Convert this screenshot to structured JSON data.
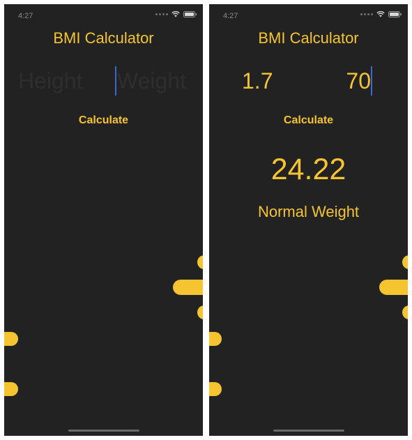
{
  "status": {
    "time": "4:27"
  },
  "app": {
    "title": "BMI Calculator",
    "calculate_label": "Calculate"
  },
  "left_screen": {
    "height_placeholder": "Height",
    "weight_placeholder": "Weight"
  },
  "right_screen": {
    "height_value": "1.7",
    "weight_value": "70",
    "bmi_value": "24.22",
    "bmi_category": "Normal Weight"
  },
  "colors": {
    "accent": "#f6c431",
    "background": "#222222",
    "caret": "#3b68d8"
  },
  "icons": [
    "signal-dots-icon",
    "wifi-icon",
    "battery-icon"
  ]
}
